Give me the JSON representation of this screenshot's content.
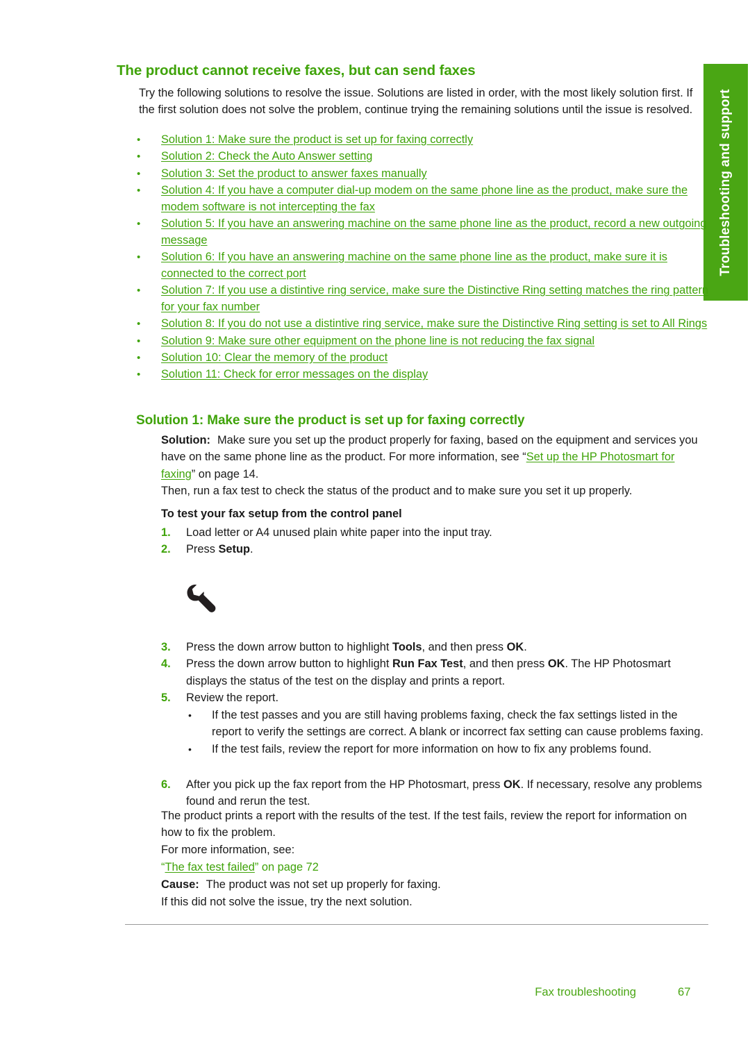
{
  "colors": {
    "accent_green": "#3fa309",
    "tab_green": "#4aa614",
    "body_text": "#1a1a1a",
    "rule": "#9a9a9a"
  },
  "side_tab": {
    "label": "Troubleshooting and support"
  },
  "topic": {
    "title": "The product cannot receive faxes, but can send faxes",
    "intro": "Try the following solutions to resolve the issue. Solutions are listed in order, with the most likely solution first. If the first solution does not solve the problem, continue trying the remaining solutions until the issue is resolved."
  },
  "solution_links": [
    "Solution 1: Make sure the product is set up for faxing correctly",
    "Solution 2: Check the Auto Answer setting",
    "Solution 3: Set the product to answer faxes manually",
    "Solution 4: If you have a computer dial-up modem on the same phone line as the product, make sure the modem software is not intercepting the fax",
    "Solution 5: If you have an answering machine on the same phone line as the product, record a new outgoing message",
    "Solution 6: If you have an answering machine on the same phone line as the product, make sure it is connected to the correct port",
    "Solution 7: If you use a distintive ring service, make sure the Distinctive Ring setting matches the ring pattern for your fax number",
    "Solution 8: If you do not use a distintive ring service, make sure the Distinctive Ring setting is set to All Rings",
    "Solution 9: Make sure other equipment on the phone line is not reducing the fax signal",
    "Solution 10: Clear the memory of the product",
    "Solution 11: Check for error messages on the display"
  ],
  "solution_1": {
    "heading": "Solution 1: Make sure the product is set up for faxing correctly",
    "solution_label": "Solution:",
    "solution_text_before_link": "Make sure you set up the product properly for faxing, based on the equipment and services you have on the same phone line as the product. For more information, see “",
    "solution_link": "Set up the HP Photosmart for faxing",
    "solution_text_after_link": "” on page 14.",
    "then_line": "Then, run a fax test to check the status of the product and to make sure you set it up properly.",
    "procedure_title": "To test your fax setup from the control panel",
    "steps": [
      {
        "num": "1.",
        "text": "Load letter or A4 unused plain white paper into the input tray."
      },
      {
        "num": "2.",
        "text_before_bold": "Press ",
        "bold": "Setup",
        "text_after_bold": "."
      }
    ],
    "figure": {
      "icon": "wrench-icon"
    },
    "steps_tail": [
      {
        "num": "3.",
        "t1": "Press the down arrow button to highlight ",
        "b1": "Tools",
        "t2": ", and then press ",
        "b2": "OK",
        "t3": "."
      },
      {
        "num": "4.",
        "t1": "Press the down arrow button to highlight ",
        "b1": "Run Fax Test",
        "t2": ", and then press ",
        "b2": "OK",
        "t3": ".",
        "sub": "The HP Photosmart displays the status of the test on the display and prints a report."
      },
      {
        "num": "5.",
        "t1": "Review the report.",
        "b1": "",
        "t2": "",
        "b2": "",
        "t3": ""
      }
    ],
    "step5_bullets": [
      "If the test passes and you are still having problems faxing, check the fax settings listed in the report to verify the settings are correct. A blank or incorrect fax setting can cause problems faxing.",
      "If the test fails, review the report for more information on how to fix any problems found."
    ],
    "step6": {
      "num": "6.",
      "t1": "After you pick up the fax report from the HP Photosmart, press ",
      "b1": "OK",
      "t2": ".",
      "sub": "If necessary, resolve any problems found and rerun the test."
    },
    "closing_1": "The product prints a report with the results of the test. If the test fails, review the report for information on how to fix the problem.",
    "closing_2": "For more information, see:",
    "xref_before": "“",
    "xref_link": "The fax test failed",
    "xref_after": "” on page 72",
    "cause_label": "Cause:",
    "cause_text": "The product was not set up properly for faxing.",
    "next_solution": "If this did not solve the issue, try the next solution."
  },
  "footer": {
    "title": "Fax troubleshooting",
    "page_number": "67"
  }
}
